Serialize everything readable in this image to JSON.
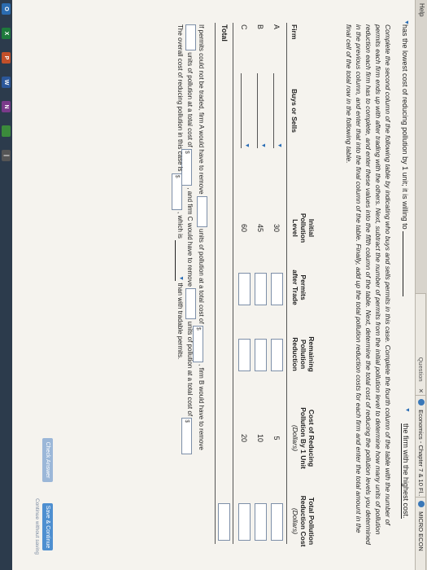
{
  "browser": {
    "menu_help": "Help",
    "tab1": "Question",
    "tab2": "Economics - Chapter 7 & 10 Fl...",
    "tab3": "MICRO ECON"
  },
  "question": {
    "sentence_start": "has the lowest cost of reducing pollution by 1 unit; it is willing to",
    "sentence_answer": "the firm with the highest cost.",
    "instructions": "Complete the second column of the following table by indicating who buys and sells permits in this case. Complete the fourth column of the table with the number of permits each firm ends up with after trading with the others. Next, subtract the number of permits from the initial pollution level to determine how many units of pollution reduction each firm has to complete, and enter these values into the fifth column of the table. Next, determine the total cost of reducing the pollution levels you determined in the previous column, and enter that into the final column of the table. Finally, add up the total pollution reduction costs for each firm and enter the total amount in the final cell of the total row in the following table."
  },
  "table": {
    "headers": {
      "firm": "Firm",
      "buys_sells": "Buys or Sells",
      "initial_1": "Initial",
      "initial_2": "Pollution",
      "initial_3": "Level",
      "permits_1": "Permits",
      "permits_2": "after Trade",
      "remaining_1": "Remaining",
      "remaining_2": "Pollution",
      "remaining_3": "Reduction",
      "cost_1": "Cost of Reducing",
      "cost_2": "Pollution By 1 Unit",
      "cost_3": "(Dollars)",
      "total_1": "Total Pollution",
      "total_2": "Reduction Cost",
      "total_3": "(Dollars)"
    },
    "rows": [
      {
        "firm": "A",
        "initial": "30",
        "cost": "5"
      },
      {
        "firm": "B",
        "initial": "45",
        "cost": "10"
      },
      {
        "firm": "C",
        "initial": "60",
        "cost": "20"
      }
    ],
    "total_label": "Total"
  },
  "followup": {
    "p1a": "If permits could not be traded, firm A would have to remove",
    "p1b": "units of pollution at a total cost of",
    "p1c": ", firm B would have to remove",
    "p2a": "units of pollution at a total cost of",
    "p2b": ", and firm C would have to remove",
    "p2c": "units of pollution at a total cost of",
    "p3a": "The overall cost of reducing pollution in this case is",
    "p3b": ", which is",
    "p3c": "than with tradable permits.",
    "dollar_sign": "$"
  },
  "buttons": {
    "check": "Check Answer",
    "save": "Save & Continue",
    "continue_link": "Continue without saving"
  },
  "taskbar": {
    "items": [
      "O",
      "X",
      "P",
      "W",
      "N",
      "",
      "|"
    ]
  }
}
